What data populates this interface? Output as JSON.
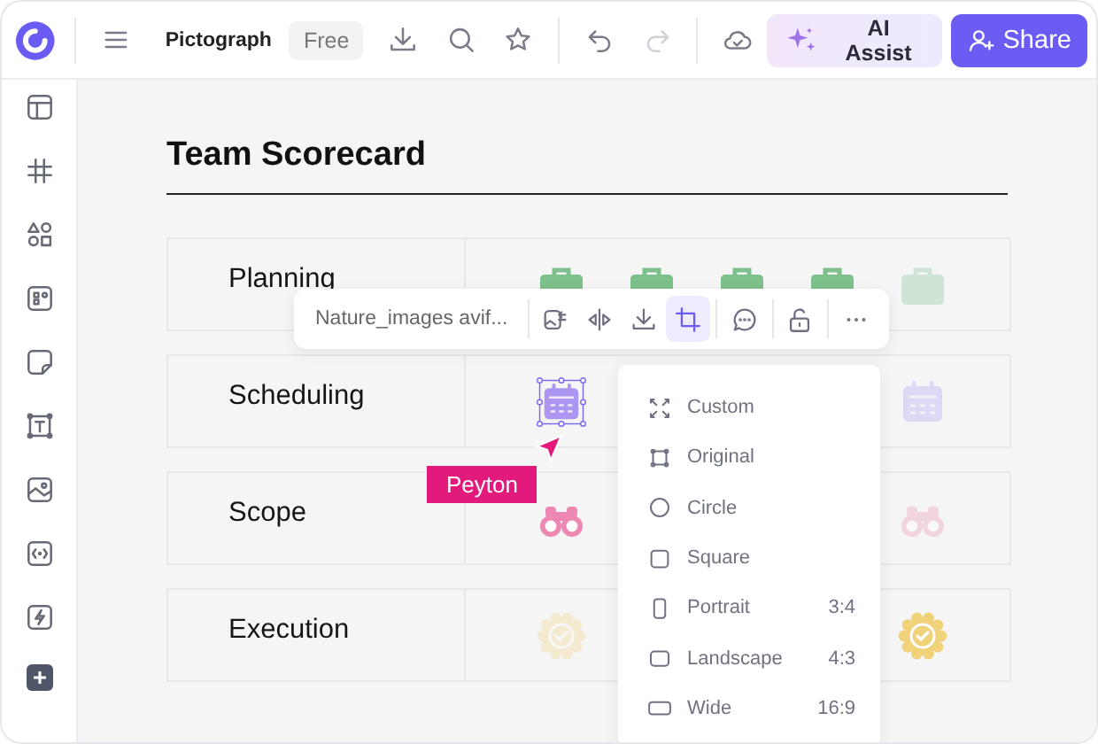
{
  "app": {
    "plan": "Free",
    "title": "Pictograph"
  },
  "topbar": {
    "tools": [
      {
        "kind": "download",
        "disabled": false
      },
      {
        "kind": "search",
        "disabled": false
      },
      {
        "kind": "star",
        "disabled": false
      },
      {
        "kind": "undo",
        "disabled": false
      },
      {
        "kind": "redo",
        "disabled": true
      },
      {
        "kind": "cloud",
        "disabled": false
      }
    ],
    "assist": "AI Assist",
    "share": "Share"
  },
  "sidebar": {
    "items": [
      {
        "kind": "layout"
      },
      {
        "kind": "grid"
      },
      {
        "kind": "shapes"
      },
      {
        "kind": "widgets"
      },
      {
        "kind": "note"
      },
      {
        "kind": "text"
      },
      {
        "kind": "image"
      },
      {
        "kind": "code"
      },
      {
        "kind": "bolt"
      },
      {
        "kind": "add"
      }
    ]
  },
  "document": {
    "title": "Team Scorecard",
    "rows": [
      {
        "label": "Planning",
        "kind": "briefcase",
        "color": "#7cc08c",
        "slots": [
          {
            "filled": true,
            "selected": false
          },
          {
            "filled": true,
            "selected": false
          },
          {
            "filled": true,
            "selected": false
          },
          {
            "filled": true,
            "selected": false
          },
          {
            "filled": false,
            "selected": false
          }
        ]
      },
      {
        "label": "Scheduling",
        "kind": "calendar",
        "color": "#ac96f2",
        "slots": [
          {
            "filled": true,
            "selected": true
          },
          {
            "filled": false,
            "selected": false
          }
        ]
      },
      {
        "label": "Scope",
        "kind": "binoculars",
        "color": "#ec88b2",
        "slots": [
          {
            "filled": true,
            "selected": false
          },
          {
            "filled": false,
            "selected": false
          }
        ]
      },
      {
        "label": "Execution",
        "kind": "badge",
        "color": "#f0d27a",
        "slots": [
          {
            "filled": false,
            "selected": false
          },
          {
            "filled": true,
            "selected": false
          }
        ]
      }
    ]
  },
  "image_toolbar": {
    "file": "Nature_images avif...",
    "tools": [
      {
        "kind": "replace",
        "selected": false
      },
      {
        "kind": "flip",
        "selected": false
      },
      {
        "kind": "download",
        "selected": false
      },
      {
        "kind": "crop",
        "selected": true
      },
      {
        "kind": "comment",
        "selected": false
      },
      {
        "kind": "lock",
        "selected": false
      },
      {
        "kind": "more",
        "selected": false
      }
    ]
  },
  "crop_menu": {
    "items": [
      {
        "kind": "custom",
        "label": "Custom"
      },
      {
        "kind": "original",
        "label": "Original"
      },
      {
        "kind": "circle",
        "label": "Circle"
      },
      {
        "kind": "square",
        "label": "Square"
      },
      {
        "kind": "portrait",
        "label": "Portrait",
        "ratio": "3:4"
      },
      {
        "kind": "landscape",
        "label": "Landscape",
        "ratio": "4:3"
      },
      {
        "kind": "wide",
        "label": "Wide",
        "ratio": "16:9"
      }
    ]
  },
  "cursor": {
    "name": "Peyton"
  }
}
